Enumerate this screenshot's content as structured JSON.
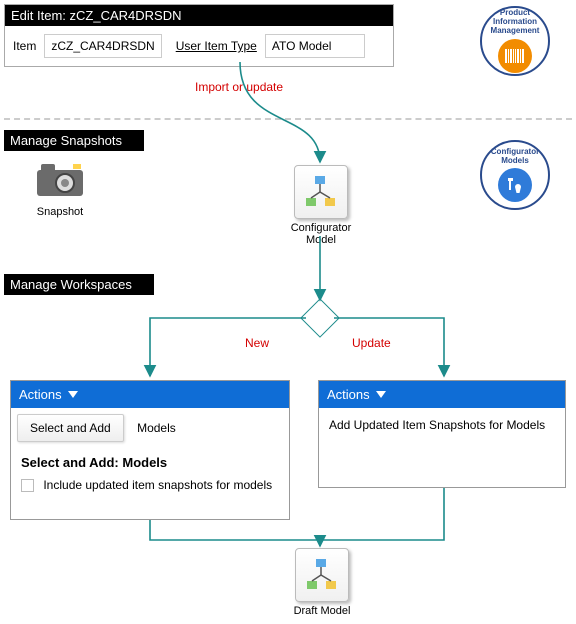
{
  "edit_panel": {
    "title": "Edit Item: zCZ_CAR4DRSDN",
    "item_label": "Item",
    "item_value": "zCZ_CAR4DRSDN",
    "user_item_type_label": "User Item Type",
    "user_item_type_value": "ATO Model"
  },
  "badges": {
    "pim": {
      "line1": "Product",
      "line2": "Information",
      "line3": "Management"
    },
    "cm": {
      "line1": "Configurator",
      "line2": "Models"
    }
  },
  "sections": {
    "snapshots": "Manage Snapshots",
    "workspaces": "Manage Workspaces"
  },
  "snapshot_caption": "Snapshot",
  "config_model_caption": "Configurator Model",
  "annotations": {
    "import_or_update": "Import or update",
    "new": "New",
    "update": "Update"
  },
  "left_panel": {
    "actions": "Actions",
    "tab1": "Select and Add",
    "tab2": "Models",
    "heading": "Select and Add: Models",
    "checkbox_label": "Include updated item snapshots for models"
  },
  "right_panel": {
    "actions": "Actions",
    "body": "Add Updated Item Snapshots for Models"
  },
  "draft_model_caption": "Draft Model"
}
